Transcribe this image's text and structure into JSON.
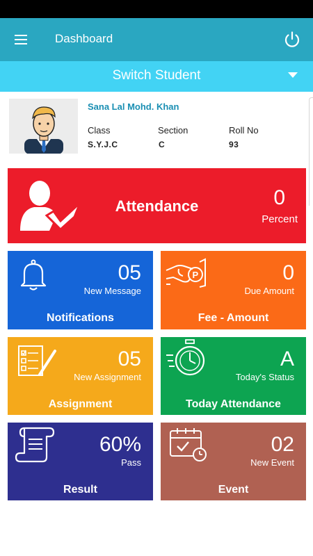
{
  "appbar": {
    "title": "Dashboard",
    "menu_icon": "menu-icon",
    "power_icon": "power-icon"
  },
  "switch_student": {
    "label": "Switch Student"
  },
  "student": {
    "name": "Sana Lal Mohd. Khan",
    "class_label": "Class",
    "class_value": "S.Y.J.C",
    "section_label": "Section",
    "section_value": "C",
    "roll_label": "Roll No",
    "roll_value": "93"
  },
  "tiles": {
    "attendance": {
      "title": "Attendance",
      "value": "0",
      "sub": "Percent",
      "color": "#ec1c2a"
    },
    "notifications": {
      "value": "05",
      "sub": "New Message",
      "title": "Notifications",
      "color": "#1565d8"
    },
    "fee": {
      "value": "0",
      "sub": "Due Amount",
      "title": "Fee - Amount",
      "color": "#fb6a17"
    },
    "assignment": {
      "value": "05",
      "sub": "New Assignment",
      "title": "Assignment",
      "color": "#f5a91b"
    },
    "today_attendance": {
      "value": "A",
      "sub": "Today's Status",
      "title": "Today Attendance",
      "color": "#0da451"
    },
    "result": {
      "value": "60%",
      "sub": "Pass",
      "title": "Result",
      "color": "#2e2f8f"
    },
    "event": {
      "value": "02",
      "sub": "New Event",
      "title": "Event",
      "color": "#b06152"
    }
  }
}
